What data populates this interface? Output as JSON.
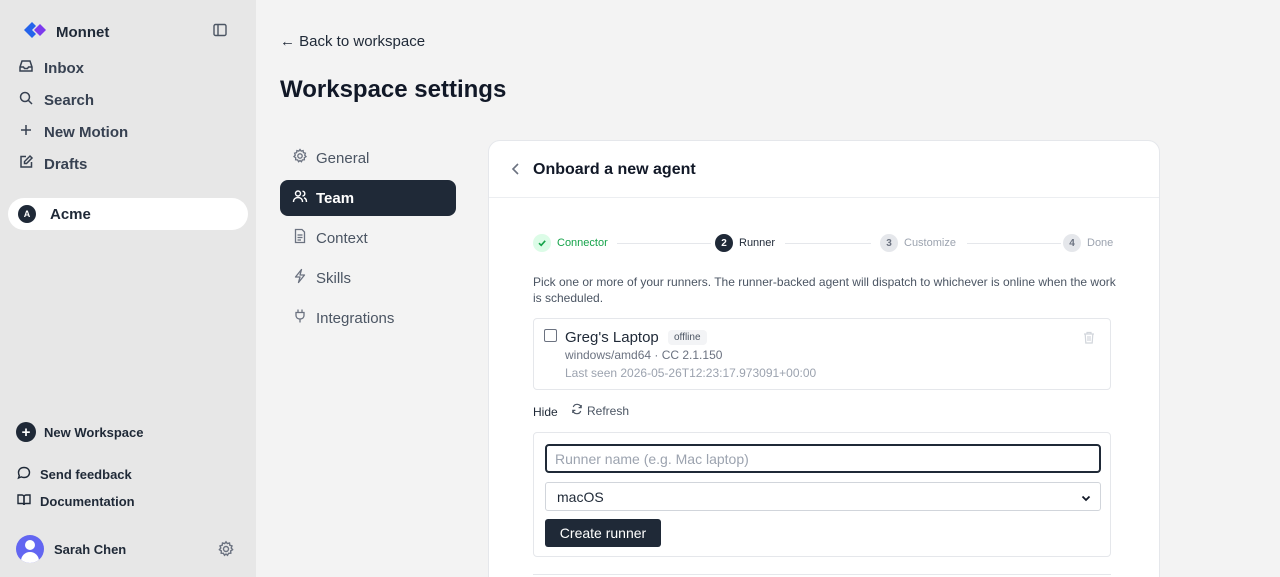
{
  "app": {
    "name": "Monnet"
  },
  "sidebar": {
    "nav": [
      {
        "label": "Inbox",
        "icon": "inbox-icon"
      },
      {
        "label": "Search",
        "icon": "search-icon"
      },
      {
        "label": "New Motion",
        "icon": "plus-icon"
      },
      {
        "label": "Drafts",
        "icon": "edit-icon"
      }
    ],
    "workspace": {
      "label": "Acme",
      "badge": "A"
    },
    "new_workspace": "New Workspace",
    "feedback": "Send feedback",
    "documentation": "Documentation",
    "user": {
      "name": "Sarah Chen"
    }
  },
  "header": {
    "back": "← Back to workspace",
    "title": "Workspace settings"
  },
  "settings_nav": [
    {
      "label": "General",
      "icon": "gear-icon",
      "active": false
    },
    {
      "label": "Team",
      "icon": "users-icon",
      "active": true
    },
    {
      "label": "Context",
      "icon": "document-icon",
      "active": false
    },
    {
      "label": "Skills",
      "icon": "bolt-icon",
      "active": false
    },
    {
      "label": "Integrations",
      "icon": "plug-icon",
      "active": false
    }
  ],
  "card": {
    "title": "Onboard a new agent",
    "steps": [
      {
        "label": "Connector",
        "state": "done"
      },
      {
        "num": "2",
        "label": "Runner",
        "state": "current"
      },
      {
        "num": "3",
        "label": "Customize",
        "state": "pending"
      },
      {
        "num": "4",
        "label": "Done",
        "state": "pending"
      }
    ],
    "description": "Pick one or more of your runners. The runner-backed agent will dispatch to whichever is online when the work is scheduled.",
    "runner": {
      "name": "Greg's Laptop",
      "status": "offline",
      "meta": "windows/amd64 · CC 2.1.150",
      "last_seen": "Last seen 2026-05-26T12:23:17.973091+00:00"
    },
    "hide_label": "Hide",
    "refresh_label": "Refresh",
    "form": {
      "name_placeholder": "Runner name (e.g. Mac laptop)",
      "name_value": "",
      "os_selected": "macOS",
      "create_label": "Create runner"
    }
  },
  "colors": {
    "accent": "#1f2937",
    "success": "#16a34a",
    "brand_blue": "#2563eb",
    "brand_purple": "#7c3aed",
    "avatar": "#6366f1"
  }
}
